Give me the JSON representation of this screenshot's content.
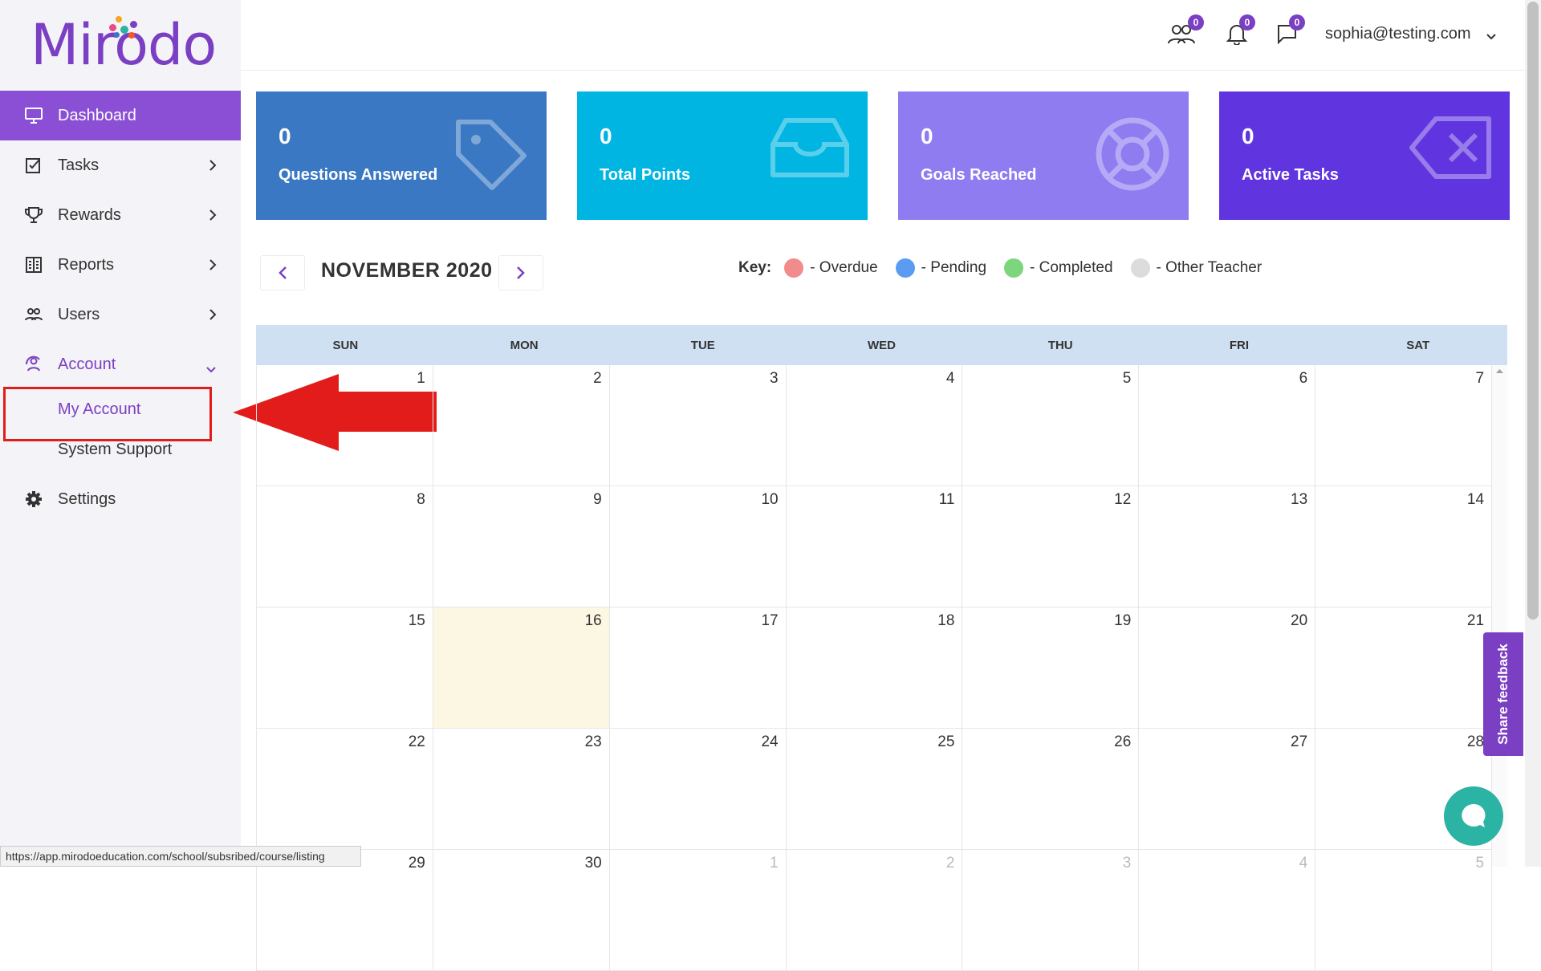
{
  "app": {
    "logo_text": "Mirodo"
  },
  "sidebar": {
    "items": [
      {
        "label": "Dashboard",
        "icon": "monitor-icon"
      },
      {
        "label": "Tasks",
        "icon": "checklist-icon"
      },
      {
        "label": "Rewards",
        "icon": "trophy-icon"
      },
      {
        "label": "Reports",
        "icon": "report-icon"
      },
      {
        "label": "Users",
        "icon": "users-icon"
      },
      {
        "label": "Account",
        "icon": "account-icon"
      }
    ],
    "account_sub": [
      {
        "label": "My Account"
      },
      {
        "label": "System Support"
      }
    ],
    "settings": {
      "label": "Settings",
      "icon": "gear-icon"
    }
  },
  "header": {
    "users_badge": "0",
    "notifications_badge": "0",
    "messages_badge": "0",
    "user_email": "sophia@testing.com"
  },
  "stats": [
    {
      "value": "0",
      "label": "Questions Answered",
      "color": "#3a78c3",
      "icon": "tag-icon"
    },
    {
      "value": "0",
      "label": "Total Points",
      "color": "#00b5e2",
      "icon": "inbox-icon"
    },
    {
      "value": "0",
      "label": "Goals Reached",
      "color": "#8e7cf0",
      "icon": "lifebuoy-icon"
    },
    {
      "value": "0",
      "label": "Active Tasks",
      "color": "#6035e0",
      "icon": "backspace-icon"
    }
  ],
  "calendar": {
    "month_title": "NOVEMBER 2020",
    "key_label": "Key:",
    "key": [
      {
        "label": "- Overdue",
        "color": "#f28b8b"
      },
      {
        "label": "- Pending",
        "color": "#5b9cf2"
      },
      {
        "label": "- Completed",
        "color": "#7dd67d"
      },
      {
        "label": "- Other Teacher",
        "color": "#dcdcdc"
      }
    ],
    "weekdays": [
      "SUN",
      "MON",
      "TUE",
      "WED",
      "THU",
      "FRI",
      "SAT"
    ],
    "weeks": [
      [
        "1",
        "2",
        "3",
        "4",
        "5",
        "6",
        "7"
      ],
      [
        "8",
        "9",
        "10",
        "11",
        "12",
        "13",
        "14"
      ],
      [
        "15",
        "16",
        "17",
        "18",
        "19",
        "20",
        "21"
      ],
      [
        "22",
        "23",
        "24",
        "25",
        "26",
        "27",
        "28"
      ],
      [
        "29",
        "30",
        "1",
        "2",
        "3",
        "4",
        "5"
      ]
    ],
    "today": "16"
  },
  "status_url": "https://app.mirodoeducation.com/school/subsribed/course/listing",
  "feedback_label": "Share feedback"
}
